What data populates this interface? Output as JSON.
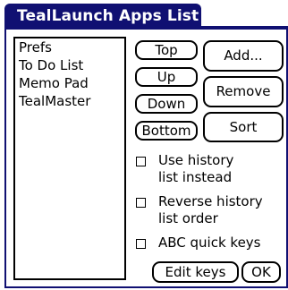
{
  "title": "TealLaunch Apps List",
  "apps": [
    "Prefs",
    "To Do List",
    "Memo Pad",
    "TealMaster"
  ],
  "buttons": {
    "top": "Top",
    "up": "Up",
    "down": "Down",
    "bottom": "Bottom",
    "add": "Add...",
    "remove": "Remove",
    "sort": "Sort",
    "edit_keys": "Edit keys",
    "ok": "OK"
  },
  "options": {
    "history": {
      "line1": "Use history",
      "line2": "list instead",
      "checked": false
    },
    "reverse": {
      "line1": "Reverse history",
      "line2": "list order",
      "checked": false
    },
    "abc": {
      "line1": "ABC quick keys",
      "checked": false
    }
  },
  "colors": {
    "title_bar": "#101072",
    "title_text": "#ffffff"
  }
}
